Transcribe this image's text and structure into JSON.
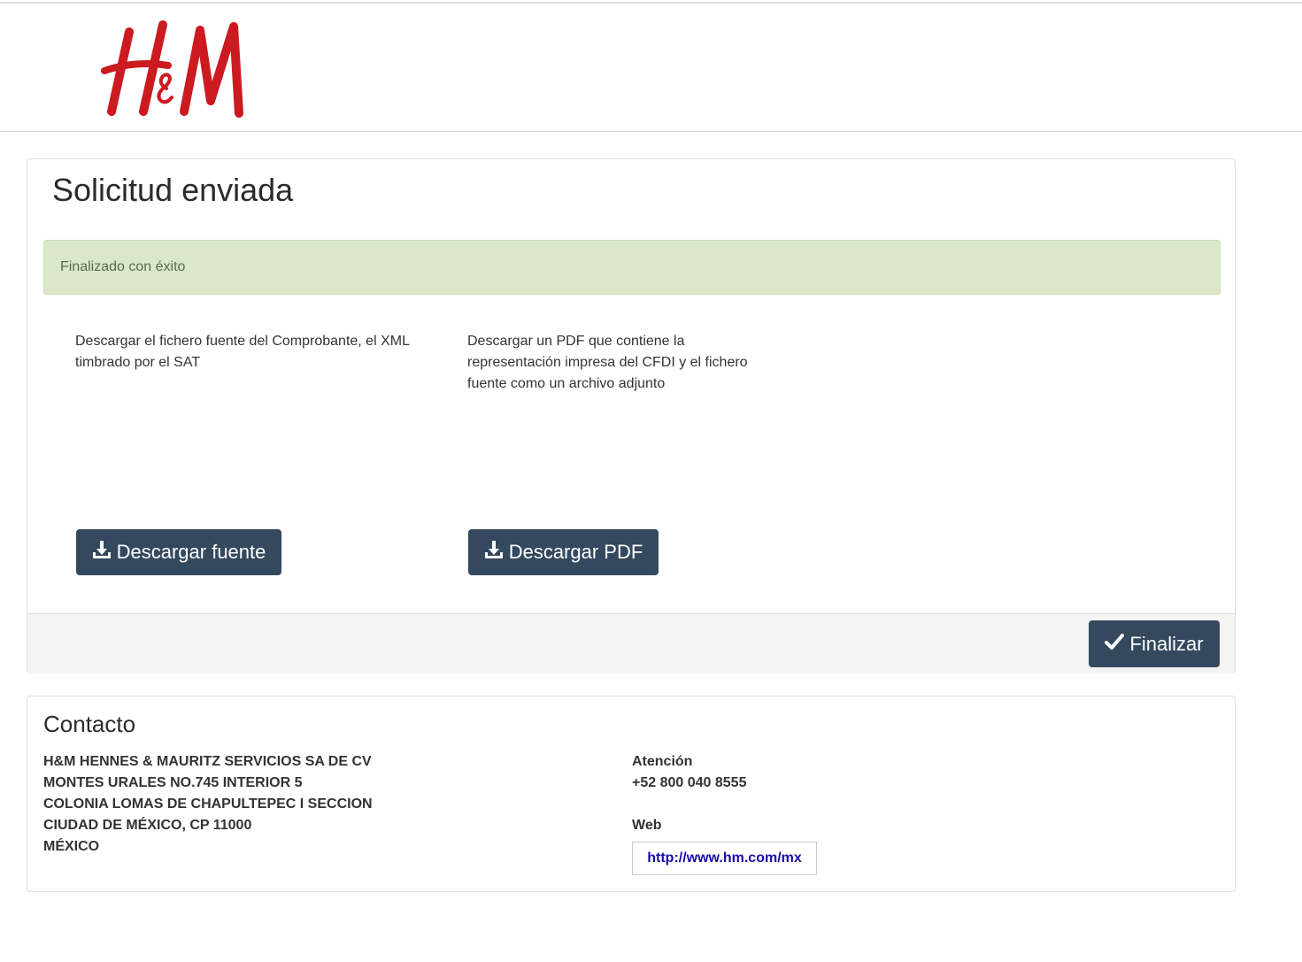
{
  "header": {
    "logo_text": "H&M",
    "brand_color": "#cc1a21"
  },
  "panel": {
    "title": "Solicitud enviada",
    "alert": "Finalizado con éxito",
    "options": [
      {
        "description": "Descargar el fichero fuente del Comprobante, el XML timbrado por el SAT",
        "button_label": "Descargar fuente",
        "icon": "download-icon"
      },
      {
        "description": "Descargar un PDF que contiene la representación impresa del CFDI y el fichero fuente como un archivo adjunto",
        "button_label": "Descargar PDF",
        "icon": "download-icon"
      }
    ],
    "finish_label": "Finalizar",
    "finish_icon": "check-icon"
  },
  "contact": {
    "title": "Contacto",
    "address_lines": [
      "H&M HENNES & MAURITZ SERVICIOS SA DE CV",
      "MONTES URALES NO.745 INTERIOR 5",
      "COLONIA LOMAS DE CHAPULTEPEC I SECCION",
      "CIUDAD DE MÉXICO, CP 11000",
      "MÉXICO"
    ],
    "attention_label": "Atención",
    "phone": "+52 800 040 8555",
    "web_label": "Web",
    "web_url": "http://www.hm.com/mx"
  },
  "colors": {
    "button_bg": "#34495e",
    "alert_bg": "#dae8c9",
    "link": "#1a0dab"
  }
}
